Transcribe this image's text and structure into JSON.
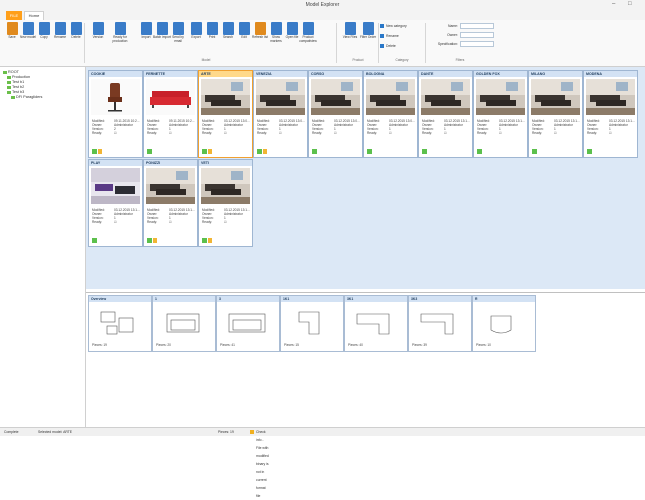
{
  "window": {
    "title": "Model Explorer",
    "minimize": "–",
    "maximize": "□"
  },
  "tabs": {
    "file": "FILE",
    "home": "Home"
  },
  "ribbon": {
    "buttons": [
      {
        "label": "Save",
        "icon": "save-icon",
        "color": "#e08a1e"
      },
      {
        "label": "New model",
        "icon": "new-model-icon",
        "color": "#3a7cc8"
      },
      {
        "label": "Copy",
        "icon": "copy-icon",
        "color": "#3a7cc8"
      },
      {
        "label": "Rename",
        "icon": "rename-icon",
        "color": "#3a7cc8"
      },
      {
        "label": "Delete",
        "icon": "delete-icon",
        "color": "#3a7cc8"
      },
      {
        "label": "Version",
        "icon": "version-icon",
        "color": "#3a7cc8"
      },
      {
        "label": "Ready for production",
        "icon": "ready-icon",
        "color": "#3a7cc8"
      },
      {
        "label": "Import",
        "icon": "import-icon",
        "color": "#3a7cc8"
      },
      {
        "label": "Batch import",
        "icon": "batch-import-icon",
        "color": "#3a7cc8"
      },
      {
        "label": "Send by email",
        "icon": "email-icon",
        "color": "#3a7cc8"
      },
      {
        "label": "Export",
        "icon": "export-icon",
        "color": "#3a7cc8"
      },
      {
        "label": "Print",
        "icon": "print-icon",
        "color": "#3a7cc8"
      },
      {
        "label": "Search",
        "icon": "search-icon",
        "color": "#3a7cc8"
      },
      {
        "label": "Edit",
        "icon": "edit-icon",
        "color": "#3a7cc8"
      },
      {
        "label": "Refresh list",
        "icon": "refresh-icon",
        "color": "#e08a1e"
      },
      {
        "label": "Show markers",
        "icon": "markers-icon",
        "color": "#3a7cc8"
      },
      {
        "label": "Open file",
        "icon": "open-file-icon",
        "color": "#3a7cc8"
      },
      {
        "label": "Product compatiview",
        "icon": "compat-icon",
        "color": "#3a7cc8"
      },
      {
        "label": "View Files",
        "icon": "view-files-icon",
        "color": "#3a7cc8"
      },
      {
        "label": "Filter Order",
        "icon": "filter-order-icon",
        "color": "#3a7cc8"
      }
    ],
    "category_buttons": [
      "New category",
      "Rename",
      "Delete"
    ],
    "groups": {
      "model": "Model",
      "product": "Product",
      "category": "Category",
      "filters": "Filters"
    },
    "filter_labels": {
      "name": "Name:",
      "owner": "Owner:",
      "specification": "Specification:"
    }
  },
  "tree": {
    "items": [
      {
        "label": "ROOT",
        "indent": 0
      },
      {
        "label": "Production",
        "indent": 1
      },
      {
        "label": "Test b1",
        "indent": 1
      },
      {
        "label": "Test b2",
        "indent": 1
      },
      {
        "label": "Test b3",
        "indent": 1
      },
      {
        "label": "DFI Paragliders",
        "indent": 2
      }
    ]
  },
  "models": [
    {
      "name": "COOKIE",
      "modified": "09.11.2015 10:2...",
      "owner": "Administrator",
      "version": "2",
      "ready": "☑",
      "image": "chair",
      "selected": false
    },
    {
      "name": "FERNETTE",
      "modified": "09.11.2015 10:2...",
      "owner": "Administrator",
      "version": "1",
      "ready": "☑",
      "image": "red-sofa",
      "selected": false
    },
    {
      "name": "ARTE",
      "modified": "03.12.2015 13:0...",
      "owner": "Administrator",
      "version": "1",
      "ready": "☑",
      "image": "room",
      "selected": true
    },
    {
      "name": "VENEZIA",
      "modified": "03.12.2015 13:0...",
      "owner": "Administrator",
      "version": "1",
      "ready": "☑",
      "image": "room",
      "selected": false
    },
    {
      "name": "CORSO",
      "modified": "03.12.2015 13:0...",
      "owner": "Administrator",
      "version": "1",
      "ready": "☑",
      "image": "room",
      "selected": false
    },
    {
      "name": "BOLOGNA",
      "modified": "03.12.2015 13:0...",
      "owner": "Administrator",
      "version": "1",
      "ready": "☑",
      "image": "room",
      "selected": false
    },
    {
      "name": "DANTE",
      "modified": "03.12.2015 13:1...",
      "owner": "Administrator",
      "version": "1",
      "ready": "☑",
      "image": "room",
      "selected": false
    },
    {
      "name": "GOLDEN FOX",
      "modified": "03.12.2015 13:1...",
      "owner": "Administrator",
      "version": "1",
      "ready": "☑",
      "image": "room",
      "selected": false
    },
    {
      "name": "MILANO",
      "modified": "03.12.2015 13:1...",
      "owner": "Administrator",
      "version": "1",
      "ready": "☑",
      "image": "room",
      "selected": false
    },
    {
      "name": "MODENA",
      "modified": "03.12.2015 13:1...",
      "owner": "Administrator",
      "version": "1",
      "ready": "☑",
      "image": "room",
      "selected": false
    },
    {
      "name": "PLAY",
      "modified": "03.12.2015 13:1...",
      "owner": "Administrator",
      "version": "1",
      "ready": "☑",
      "image": "purple",
      "selected": false
    },
    {
      "name": "PONIZZI",
      "modified": "03.12.2015 13:1...",
      "owner": "Administrator",
      "version": "1",
      "ready": "☑",
      "image": "room",
      "selected": false
    },
    {
      "name": "VETI",
      "modified": "03.12.2015 13:1...",
      "owner": "Administrator",
      "version": "1",
      "ready": "☑",
      "image": "room",
      "selected": false
    }
  ],
  "card_labels": {
    "modified": "Modified:",
    "owner": "Owner:",
    "version": "Version:",
    "ready": "Ready:"
  },
  "parts": [
    {
      "name": "Overview",
      "pieces": "19"
    },
    {
      "name": "1",
      "pieces": "20"
    },
    {
      "name": "3",
      "pieces": "41"
    },
    {
      "name": "1K1",
      "pieces": "15"
    },
    {
      "name": "3K1",
      "pieces": "40"
    },
    {
      "name": "3K3",
      "pieces": "39"
    },
    {
      "name": "R",
      "pieces": "10"
    }
  ],
  "parts_label": "Pieces:",
  "statusbar": {
    "left": "Complete",
    "model": "Selected model: ARTE",
    "pieces": "Pieces: 19",
    "message": "Check info - File with modified binary is not in current format file"
  }
}
